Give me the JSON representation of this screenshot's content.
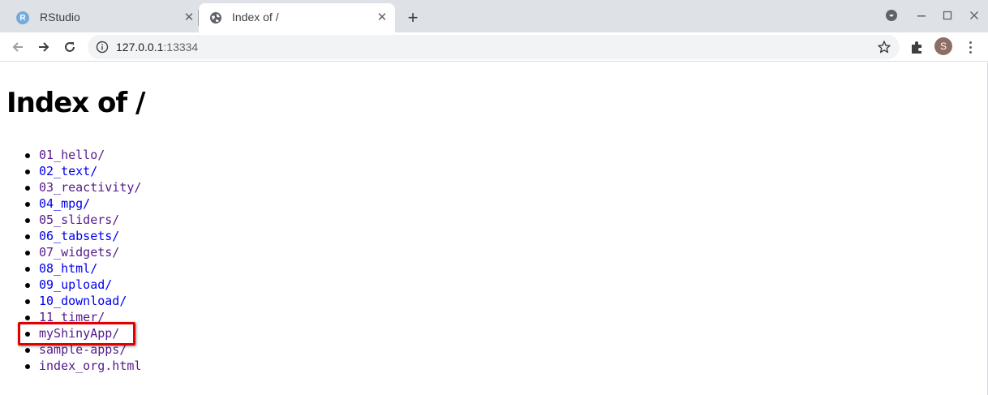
{
  "browser": {
    "tabs": [
      {
        "title": "RStudio",
        "favicon": "rstudio-icon",
        "active": false
      },
      {
        "title": "Index of /",
        "favicon": "globe-icon",
        "active": true
      }
    ],
    "address_bar": {
      "host": "127.0.0.1",
      "port": ":13334"
    },
    "profile_initial": "S"
  },
  "page": {
    "heading": "Index of /",
    "entries": [
      {
        "name": "01_hello/",
        "visited": true
      },
      {
        "name": "02_text/",
        "visited": false
      },
      {
        "name": "03_reactivity/",
        "visited": true
      },
      {
        "name": "04_mpg/",
        "visited": false
      },
      {
        "name": "05_sliders/",
        "visited": true
      },
      {
        "name": "06_tabsets/",
        "visited": false
      },
      {
        "name": "07_widgets/",
        "visited": true
      },
      {
        "name": "08_html/",
        "visited": false
      },
      {
        "name": "09_upload/",
        "visited": false
      },
      {
        "name": "10_download/",
        "visited": false
      },
      {
        "name": "11_timer/",
        "visited": true
      },
      {
        "name": "myShinyApp/",
        "visited": true,
        "highlighted": true
      },
      {
        "name": "sample-apps/",
        "visited": true
      },
      {
        "name": "index_org.html",
        "visited": true
      }
    ]
  },
  "colors": {
    "visited_link": "#551a8b",
    "unvisited_link": "#0000ee",
    "highlight": "#e00000"
  }
}
